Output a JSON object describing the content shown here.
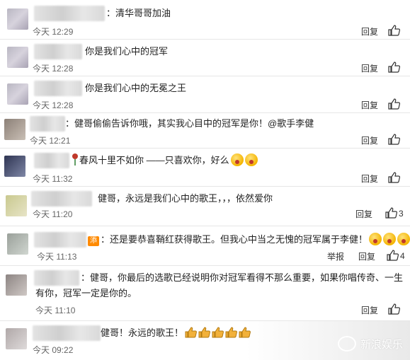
{
  "comments": [
    {
      "text": "：清华哥哥加油",
      "time": "今天 12:29",
      "reply": "回复"
    },
    {
      "text": "你是我们心中的冠军",
      "time": "今天 12:28",
      "reply": "回复"
    },
    {
      "text": "你是我们心中的无冕之王",
      "time": "今天 12:28",
      "reply": "回复"
    },
    {
      "text": "：健哥偷偷告诉你哦，其实我心目中的冠军是你！@歌手李健",
      "time": "今天 12:21",
      "reply": "回复"
    },
    {
      "text": "春风十里不如你 ——只喜欢你，好么",
      "time": "今天 11:32",
      "reply": "回复"
    },
    {
      "text": "健哥，永远是我们心中的歌王，，，依然爱你",
      "time": "今天 11:20",
      "reply": "回复",
      "likes": "3"
    },
    {
      "badge": "添",
      "text": "：还是要恭喜鞘红获得歌王。但我心中当之无愧的冠军属于李健！",
      "time": "今天 11:13",
      "report": "举报",
      "reply": "回复",
      "likes": "4"
    },
    {
      "text": "：健哥，你最后的选歌已经说明你对冠军看得不那么重要，如果你唱传奇、一生有你，冠军一定是你的。",
      "time": "今天 11:10",
      "reply": "回复"
    },
    {
      "text": "健哥！永远的歌王！",
      "time": "今天 09:22"
    }
  ],
  "watermark": "新浪娱乐"
}
